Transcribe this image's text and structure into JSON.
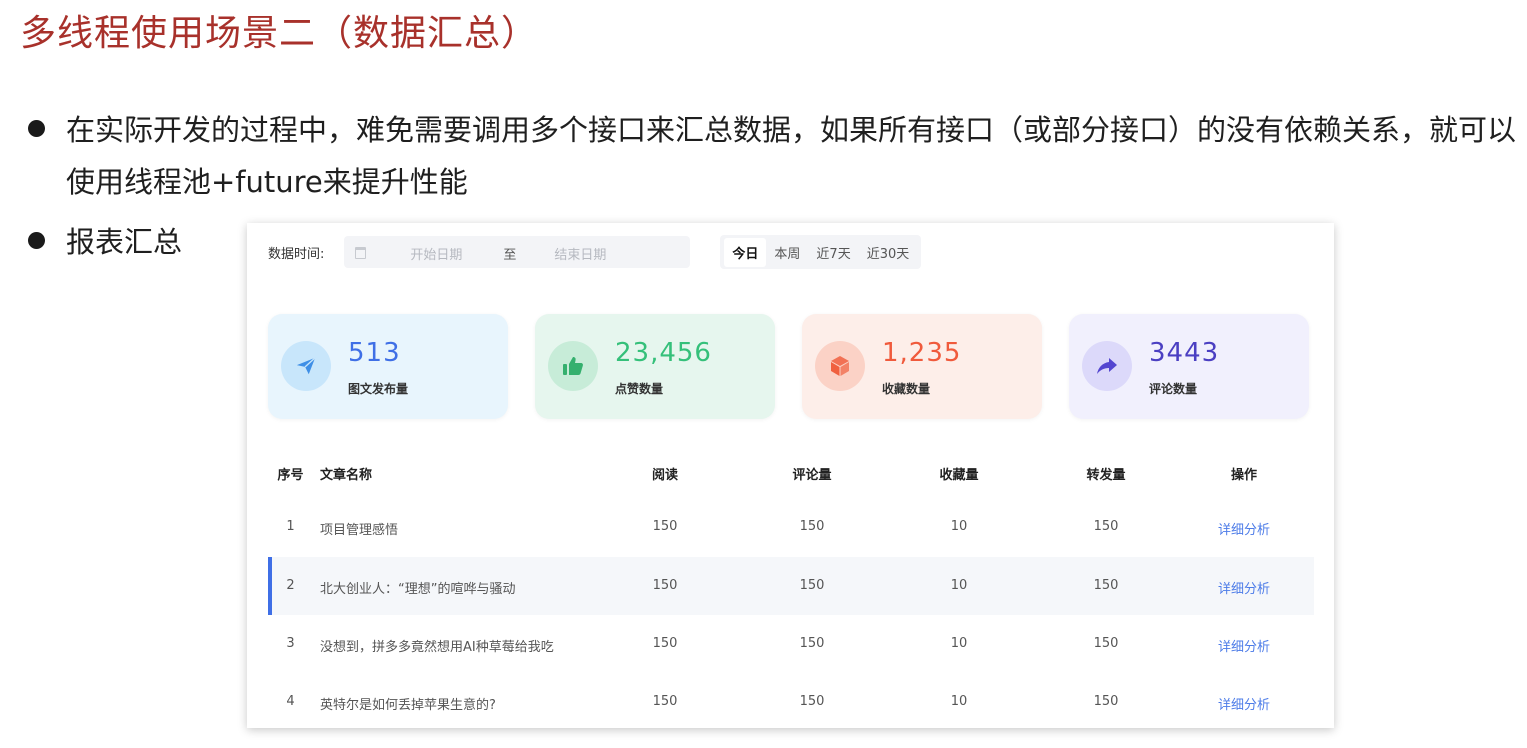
{
  "slide": {
    "title": "多线程使用场景二（数据汇总）",
    "bullets": [
      "在实际开发的过程中，难免需要调用多个接口来汇总数据，如果所有接口（或部分接口）的没有依赖关系，就可以使用线程池+future来提升性能",
      "报表汇总"
    ]
  },
  "filter": {
    "label": "数据时间:",
    "start_placeholder": "开始日期",
    "separator": "至",
    "end_placeholder": "结束日期",
    "tabs": [
      "今日",
      "本周",
      "近7天",
      "近30天"
    ],
    "active_tab": "今日"
  },
  "stats": [
    {
      "value": "513",
      "label": "图文发布量",
      "icon": "paper-plane-icon",
      "value_color": "#3f6fe6",
      "bg": "#e8f5fd",
      "icon_bg": "#c8e6fb",
      "icon_color": "#3f8fe6"
    },
    {
      "value": "23,456",
      "label": "点赞数量",
      "icon": "thumbs-up-icon",
      "value_color": "#35c07a",
      "bg": "#e6f6ee",
      "icon_bg": "#c7ecd8",
      "icon_color": "#35b06e"
    },
    {
      "value": "1,235",
      "label": "收藏数量",
      "icon": "box-icon",
      "value_color": "#f05a3c",
      "bg": "#fdeee9",
      "icon_bg": "#fbd2c6",
      "icon_color": "#f0603f"
    },
    {
      "value": "3443",
      "label": "评论数量",
      "icon": "share-arrow-icon",
      "value_color": "#4b3fc2",
      "bg": "#f1f0fd",
      "icon_bg": "#dcd9fa",
      "icon_color": "#5446d0"
    }
  ],
  "table": {
    "headers": {
      "no": "序号",
      "title": "文章名称",
      "read": "阅读",
      "comment": "评论量",
      "fav": "收藏量",
      "share": "转发量",
      "action": "操作"
    },
    "rows": [
      {
        "no": "1",
        "title": "项目管理感悟",
        "read": "150",
        "comment": "150",
        "fav": "10",
        "share": "150",
        "action": "详细分析"
      },
      {
        "no": "2",
        "title": "北大创业人：“理想”的喧哗与骚动",
        "read": "150",
        "comment": "150",
        "fav": "10",
        "share": "150",
        "action": "详细分析"
      },
      {
        "no": "3",
        "title": "没想到，拼多多竟然想用AI种草莓给我吃",
        "read": "150",
        "comment": "150",
        "fav": "10",
        "share": "150",
        "action": "详细分析"
      },
      {
        "no": "4",
        "title": "英特尔是如何丢掉苹果生意的?",
        "read": "150",
        "comment": "150",
        "fav": "10",
        "share": "150",
        "action": "详细分析"
      }
    ],
    "highlight_row_index": 1,
    "highlight_color": "#3f6fe6"
  }
}
